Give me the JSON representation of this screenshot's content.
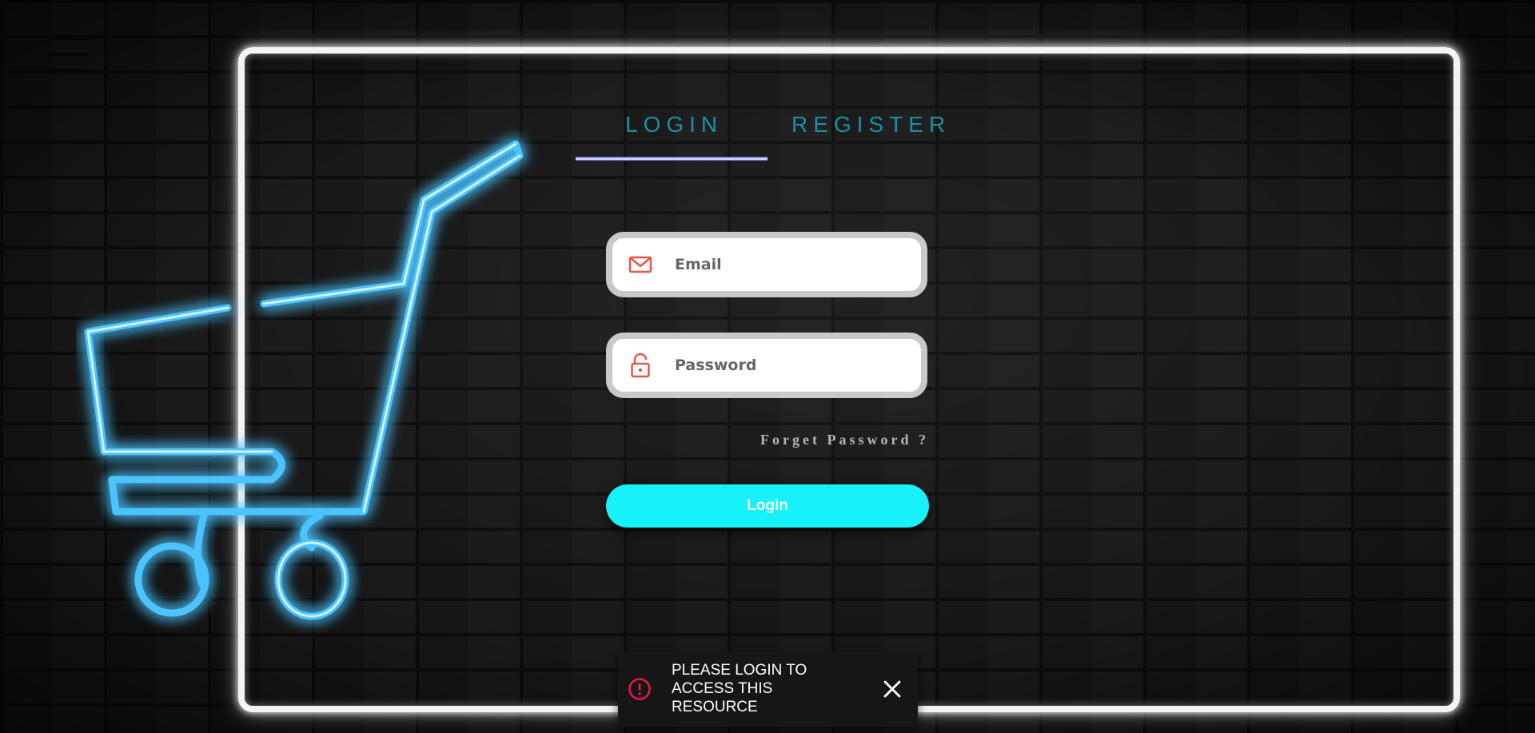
{
  "colors": {
    "tab_text": "#1a8fa3",
    "button_bg": "#17f1f9",
    "icon_red": "#e0584b",
    "toast_icon": "#e8174c"
  },
  "icons": {
    "menu": "hamburger-menu-icon",
    "cart": "shopping-cart-neon-icon",
    "email": "mail-icon",
    "password": "lock-icon",
    "alert": "alert-circle-icon",
    "close": "close-icon"
  },
  "tabs": {
    "login_label": "LOGIN",
    "register_label": "REGISTER",
    "active": "LOGIN"
  },
  "form": {
    "email_placeholder": "Email",
    "email_value": "",
    "password_placeholder": "Password",
    "password_value": "",
    "forgot_label": "Forget Password ?",
    "submit_label": "Login"
  },
  "toast": {
    "message": "PLEASE LOGIN TO ACCESS THIS RESOURCE"
  }
}
